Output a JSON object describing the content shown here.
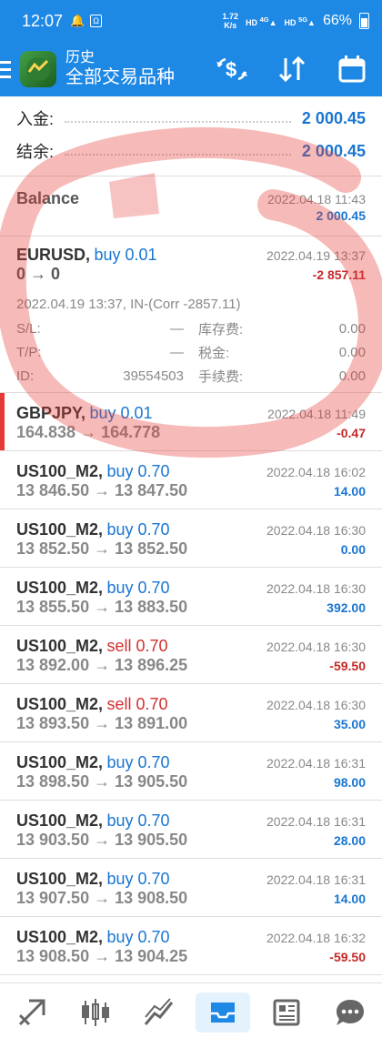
{
  "status": {
    "time": "12:07",
    "app_badge": "Ω",
    "net_speed_top": "1.72",
    "net_speed_bottom": "K/s",
    "hd1": "HD",
    "sig1": "4G",
    "hd2": "HD",
    "sig2": "5G",
    "battery": "66%"
  },
  "appbar": {
    "title": "历史",
    "subtitle": "全部交易品种",
    "icons": [
      "currency-swap-icon",
      "sort-icon",
      "calendar-icon"
    ]
  },
  "summary": {
    "deposit_label": "入金:",
    "deposit_value": "2 000.45",
    "balance_label": "结余:",
    "balance_value": "2 000.45"
  },
  "balance_row": {
    "label": "Balance",
    "date": "2022.04.18 11:43",
    "amount": "2 000.45"
  },
  "eurusd": {
    "symbol": "EURUSD,",
    "side": "buy 0.01",
    "date": "2022.04.19 13:37",
    "prices": "0 → 0",
    "profit": "-2 857.11",
    "detail_line": "2022.04.19 13:37, IN-(Corr -2857.11)",
    "sl_label": "S/L:",
    "sl_value": "—",
    "swap_label": "库存费:",
    "swap_value": "0.00",
    "tp_label": "T/P:",
    "tp_value": "—",
    "tax_label": "税金:",
    "tax_value": "0.00",
    "id_label": "ID:",
    "id_value": "39554503",
    "fee_label": "手续费:",
    "fee_value": "0.00"
  },
  "trades": [
    {
      "symbol": "GBPJPY,",
      "side": "buy 0.01",
      "side_type": "buy",
      "date": "2022.04.18 11:49",
      "prices": "164.838 → 164.778",
      "profit": "-0.47",
      "profit_sign": "neg"
    },
    {
      "symbol": "US100_M2,",
      "side": "buy 0.70",
      "side_type": "buy",
      "date": "2022.04.18 16:02",
      "prices": "13 846.50 → 13 847.50",
      "profit": "14.00",
      "profit_sign": "pos"
    },
    {
      "symbol": "US100_M2,",
      "side": "buy 0.70",
      "side_type": "buy",
      "date": "2022.04.18 16:30",
      "prices": "13 852.50 → 13 852.50",
      "profit": "0.00",
      "profit_sign": "pos"
    },
    {
      "symbol": "US100_M2,",
      "side": "buy 0.70",
      "side_type": "buy",
      "date": "2022.04.18 16:30",
      "prices": "13 855.50 → 13 883.50",
      "profit": "392.00",
      "profit_sign": "pos"
    },
    {
      "symbol": "US100_M2,",
      "side": "sell 0.70",
      "side_type": "sell",
      "date": "2022.04.18 16:30",
      "prices": "13 892.00 → 13 896.25",
      "profit": "-59.50",
      "profit_sign": "neg"
    },
    {
      "symbol": "US100_M2,",
      "side": "sell 0.70",
      "side_type": "sell",
      "date": "2022.04.18 16:30",
      "prices": "13 893.50 → 13 891.00",
      "profit": "35.00",
      "profit_sign": "pos"
    },
    {
      "symbol": "US100_M2,",
      "side": "buy 0.70",
      "side_type": "buy",
      "date": "2022.04.18 16:31",
      "prices": "13 898.50 → 13 905.50",
      "profit": "98.00",
      "profit_sign": "pos"
    },
    {
      "symbol": "US100_M2,",
      "side": "buy 0.70",
      "side_type": "buy",
      "date": "2022.04.18 16:31",
      "prices": "13 903.50 → 13 905.50",
      "profit": "28.00",
      "profit_sign": "pos"
    },
    {
      "symbol": "US100_M2,",
      "side": "buy 0.70",
      "side_type": "buy",
      "date": "2022.04.18 16:31",
      "prices": "13 907.50 → 13 908.50",
      "profit": "14.00",
      "profit_sign": "pos"
    },
    {
      "symbol": "US100_M2,",
      "side": "buy 0.70",
      "side_type": "buy",
      "date": "2022.04.18 16:32",
      "prices": "13 908.50 → 13 904.25",
      "profit": "-59.50",
      "profit_sign": "neg"
    }
  ],
  "bottom_nav": [
    {
      "name": "quotes-icon",
      "active": false
    },
    {
      "name": "chart-candles-icon",
      "active": false
    },
    {
      "name": "trade-icon",
      "active": false
    },
    {
      "name": "history-inbox-icon",
      "active": true
    },
    {
      "name": "news-icon",
      "active": false
    },
    {
      "name": "chat-icon",
      "active": false
    }
  ],
  "colors": {
    "accent": "#1e88e5",
    "buy": "#1976d2",
    "sell": "#d32f2f",
    "annotation": "#ef5350"
  }
}
